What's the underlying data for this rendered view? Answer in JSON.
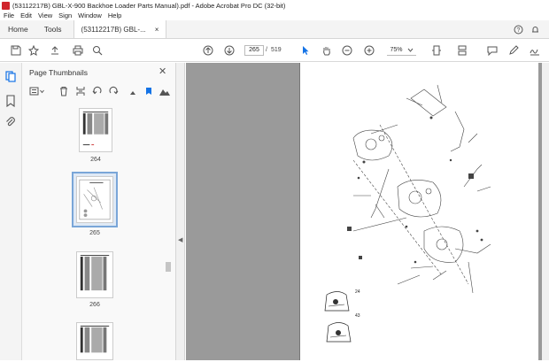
{
  "window": {
    "title": "(53112217B) GBL-X-900 Backhoe Loader Parts Manual).pdf - Adobe Acrobat Pro DC (32-bit)"
  },
  "menu": [
    "File",
    "Edit",
    "View",
    "Sign",
    "Window",
    "Help"
  ],
  "tabs": {
    "home": "Home",
    "tools": "Tools",
    "document": "(53112217B) GBL-...",
    "close": "×"
  },
  "toolbar": {
    "current_page": "265",
    "page_separator": "/",
    "total_pages": "519",
    "zoom": "75%"
  },
  "panel": {
    "title": "Page Thumbnails",
    "close": "✕",
    "thumbnails": [
      {
        "label": "264"
      },
      {
        "label": "265"
      },
      {
        "label": "266"
      }
    ]
  },
  "drawing": {
    "callouts": [
      "24",
      "43"
    ]
  },
  "colors": {
    "accent": "#1473e6",
    "appicon": "#d0262d",
    "selection": "#7aa6d8",
    "canvas": "#9a9a9a"
  }
}
